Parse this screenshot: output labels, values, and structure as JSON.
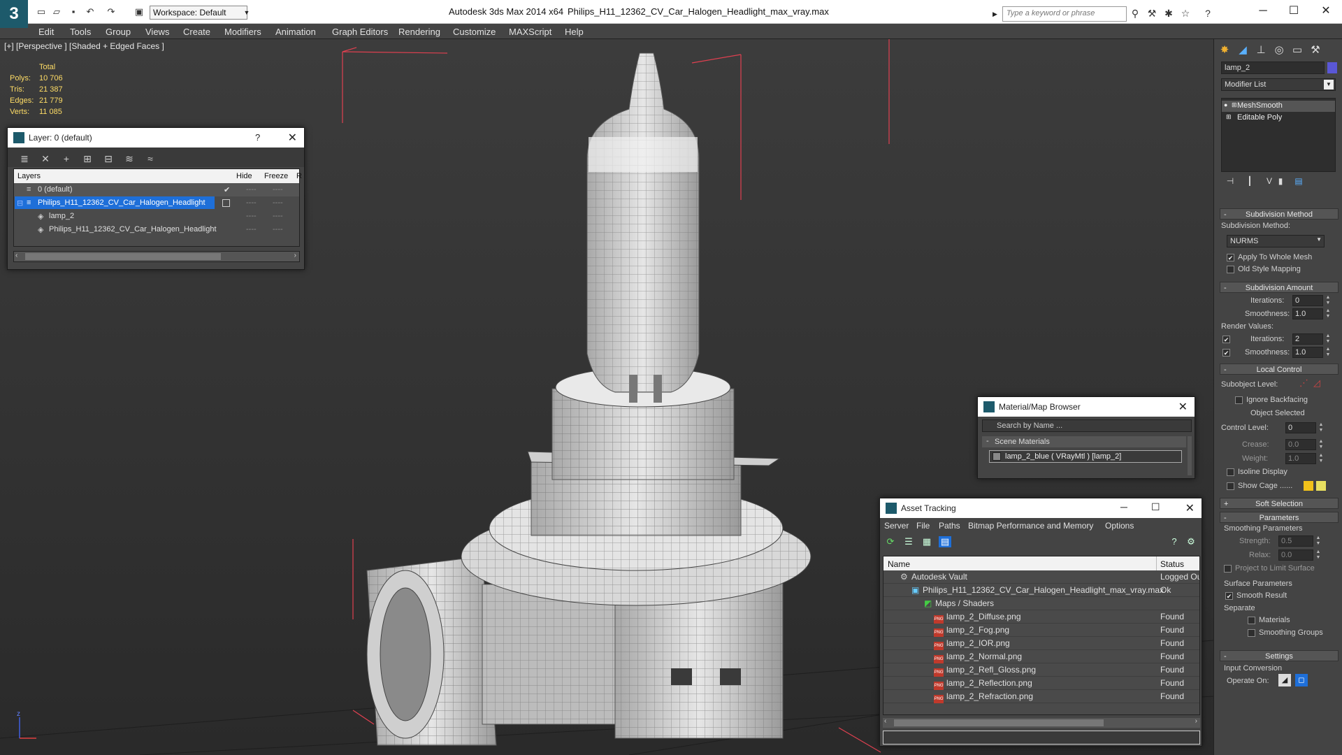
{
  "titlebar": {
    "app_name": "Autodesk 3ds Max  2014 x64",
    "file_name": "Philips_H11_12362_CV_Car_Halogen_Headlight_max_vray.max",
    "workspace": "Workspace: Default",
    "search_placeholder": "Type a keyword or phrase"
  },
  "menu": [
    "Edit",
    "Tools",
    "Group",
    "Views",
    "Create",
    "Modifiers",
    "Animation",
    "Graph Editors",
    "Rendering",
    "Customize",
    "MAXScript",
    "Help"
  ],
  "viewport": {
    "label": "[+] [Perspective ] [Shaded + Edged Faces ]",
    "stats": {
      "header": "Total",
      "rows": [
        {
          "k": "Polys:",
          "v": "10 706"
        },
        {
          "k": "Tris:",
          "v": "21 387"
        },
        {
          "k": "Edges:",
          "v": "21 779"
        },
        {
          "k": "Verts:",
          "v": "11 085"
        }
      ]
    }
  },
  "layer_dialog": {
    "title": "Layer: 0 (default)",
    "help": "?",
    "columns": {
      "layers": "Layers",
      "hide": "Hide",
      "freeze": "Freeze",
      "r": "R"
    },
    "rows": [
      {
        "name": "0 (default)"
      },
      {
        "name": "Philips_H11_12362_CV_Car_Halogen_Headlight"
      },
      {
        "name": "lamp_2"
      },
      {
        "name": "Philips_H11_12362_CV_Car_Halogen_Headlight"
      }
    ],
    "dash": "----"
  },
  "command_panel": {
    "object_name": "lamp_2",
    "modifier_list": "Modifier List",
    "stack": [
      "MeshSmooth",
      "Editable Poly"
    ],
    "rollouts": {
      "subdivision_method": "Subdivision Method",
      "subdivision_amount": "Subdivision Amount",
      "local_control": "Local Control",
      "soft_selection": "Soft Selection",
      "parameters": "Parameters",
      "settings": "Settings"
    },
    "subdiv_method_label": "Subdivision Method:",
    "subdiv_method_value": "NURMS",
    "apply_whole_mesh": "Apply To Whole Mesh",
    "old_style_mapping": "Old Style Mapping",
    "iterations_label": "Iterations:",
    "iterations_value": "0",
    "smoothness_label": "Smoothness:",
    "smoothness_value": "1.0",
    "render_values": "Render Values:",
    "render_iterations_value": "2",
    "render_smoothness_value": "1.0",
    "subobject_level": "Subobject Level:",
    "ignore_backfacing": "Ignore Backfacing",
    "object_selected": "Object Selected",
    "control_level_label": "Control Level:",
    "control_level_value": "0",
    "crease_label": "Crease:",
    "crease_value": "0.0",
    "weight_label": "Weight:",
    "weight_value": "1.0",
    "isoline_display": "Isoline Display",
    "show_cage": "Show Cage ......",
    "smoothing_parameters": "Smoothing Parameters",
    "strength_label": "Strength:",
    "strength_value": "0.5",
    "relax_label": "Relax:",
    "relax_value": "0.0",
    "project_limit": "Project to Limit Surface",
    "surface_parameters": "Surface Parameters",
    "smooth_result": "Smooth Result",
    "separate": "Separate",
    "materials": "Materials",
    "smoothing_groups": "Smoothing Groups",
    "input_conversion": "Input Conversion",
    "operate_on": "Operate On:",
    "colors": {
      "swatch": "#5a57d6",
      "cage1": "#f2c21a",
      "cage2": "#e8e060"
    }
  },
  "material_browser": {
    "title": "Material/Map Browser",
    "search_placeholder": "Search by Name ...",
    "section": "Scene Materials",
    "item": "lamp_2_blue  ( VRayMtl )  [lamp_2]"
  },
  "asset_tracking": {
    "title": "Asset Tracking",
    "menu": [
      "Server",
      "File",
      "Paths",
      "Bitmap Performance and Memory",
      "Options"
    ],
    "columns": {
      "name": "Name",
      "status": "Status"
    },
    "rows": [
      {
        "name": "Autodesk Vault",
        "status": "Logged Ou"
      },
      {
        "name": "Philips_H11_12362_CV_Car_Halogen_Headlight_max_vray.max",
        "status": "Ok"
      },
      {
        "name": "Maps / Shaders",
        "status": ""
      },
      {
        "name": "lamp_2_Diffuse.png",
        "status": "Found"
      },
      {
        "name": "lamp_2_Fog.png",
        "status": "Found"
      },
      {
        "name": "lamp_2_IOR.png",
        "status": "Found"
      },
      {
        "name": "lamp_2_Normal.png",
        "status": "Found"
      },
      {
        "name": "lamp_2_Refl_Gloss.png",
        "status": "Found"
      },
      {
        "name": "lamp_2_Reflection.png",
        "status": "Found"
      },
      {
        "name": "lamp_2_Refraction.png",
        "status": "Found"
      }
    ],
    "png_badge": "PNG"
  },
  "accent": {
    "selection": "#1e6fd9",
    "stats": "#ffdd66",
    "bbox": "#e04050"
  }
}
